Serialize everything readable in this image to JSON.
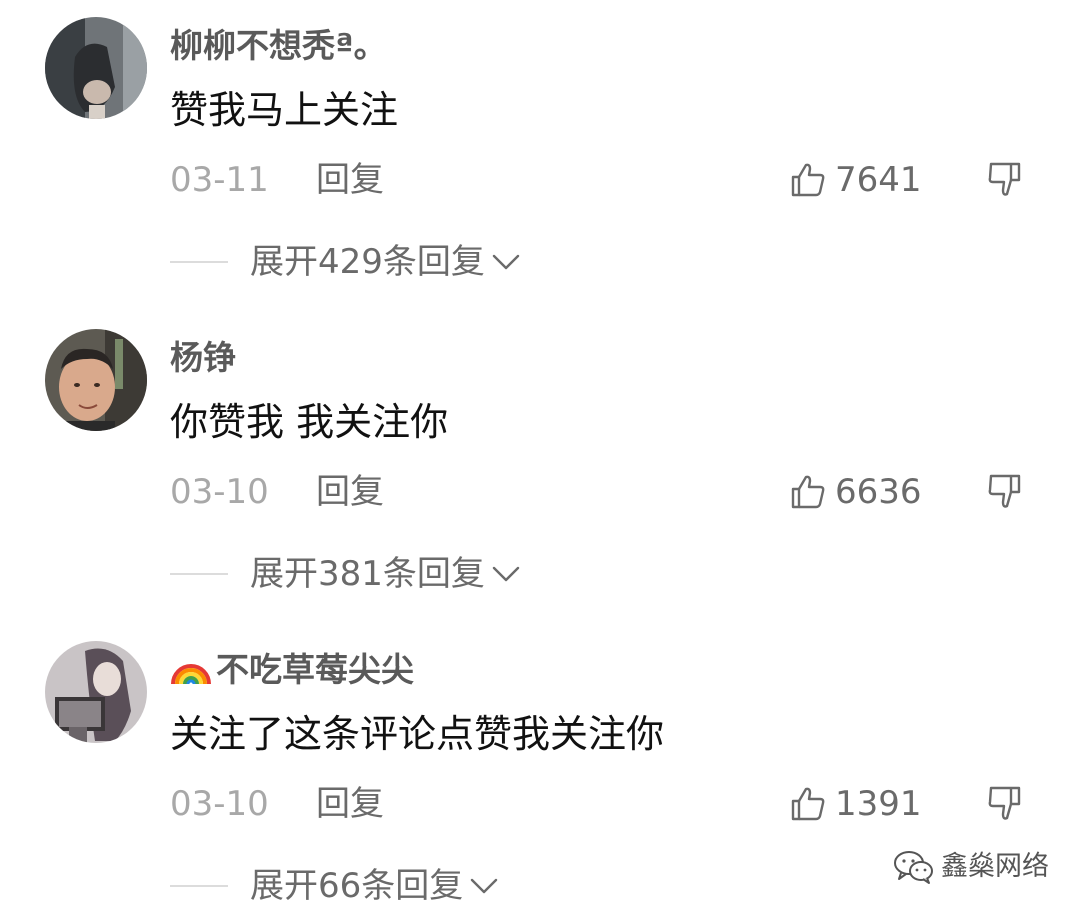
{
  "comments": [
    {
      "username": "柳柳不想秃ª。",
      "text": "赞我马上关注",
      "date": "03-11",
      "reply_label": "回复",
      "likes": "7641",
      "expand_label": "展开429条回复"
    },
    {
      "username": "杨铮",
      "text": "你赞我 我关注你",
      "date": "03-10",
      "reply_label": "回复",
      "likes": "6636",
      "expand_label": "展开381条回复"
    },
    {
      "username": "不吃草莓尖尖",
      "username_emoji": "rainbow-icon",
      "text": "关注了这条评论点赞我关注你",
      "date": "03-10",
      "reply_label": "回复",
      "likes": "1391",
      "expand_label": "展开66条回复"
    }
  ],
  "watermark": {
    "icon": "wechat-icon",
    "text": "鑫燊网络"
  },
  "colors": {
    "username": "#5a5a5a",
    "text": "#111111",
    "meta": "#a8a8a8",
    "action": "#6a6a6a"
  }
}
